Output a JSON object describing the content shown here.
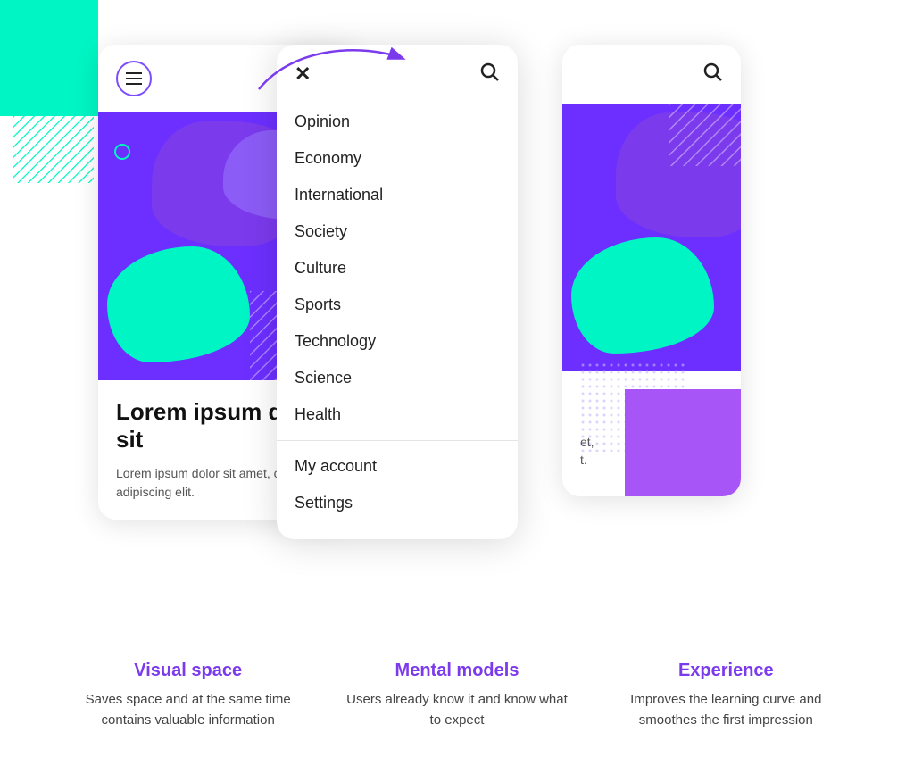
{
  "background": {
    "teal_color": "#00f5c4",
    "purple_color": "#7c3aed"
  },
  "arrow": {
    "label": "arrow pointing from hamburger to menu"
  },
  "phone_left": {
    "header": {
      "menu_label": "☰",
      "search_label": "🔍"
    },
    "article": {
      "title": "Lorem ipsum dolor sit",
      "description": "Lorem ipsum dolor sit amet, consectetur adipiscing elit."
    }
  },
  "menu": {
    "close_label": "✕",
    "search_label": "🔍",
    "items": [
      {
        "label": "Opinion"
      },
      {
        "label": "Economy"
      },
      {
        "label": "International"
      },
      {
        "label": "Society"
      },
      {
        "label": "Culture"
      },
      {
        "label": "Sports"
      },
      {
        "label": "Technology"
      },
      {
        "label": "Science"
      },
      {
        "label": "Health"
      }
    ],
    "secondary_items": [
      {
        "label": "My account"
      },
      {
        "label": "Settings"
      }
    ]
  },
  "phone_right": {
    "text_partial_1": "et,",
    "text_partial_2": "t."
  },
  "features": [
    {
      "title": "Visual space",
      "description": "Saves space and at the same time contains valuable information"
    },
    {
      "title": "Mental models",
      "description": "Users already know it and know what to expect"
    },
    {
      "title": "Experience",
      "description": "Improves the learning curve and smoothes the first impression"
    }
  ]
}
